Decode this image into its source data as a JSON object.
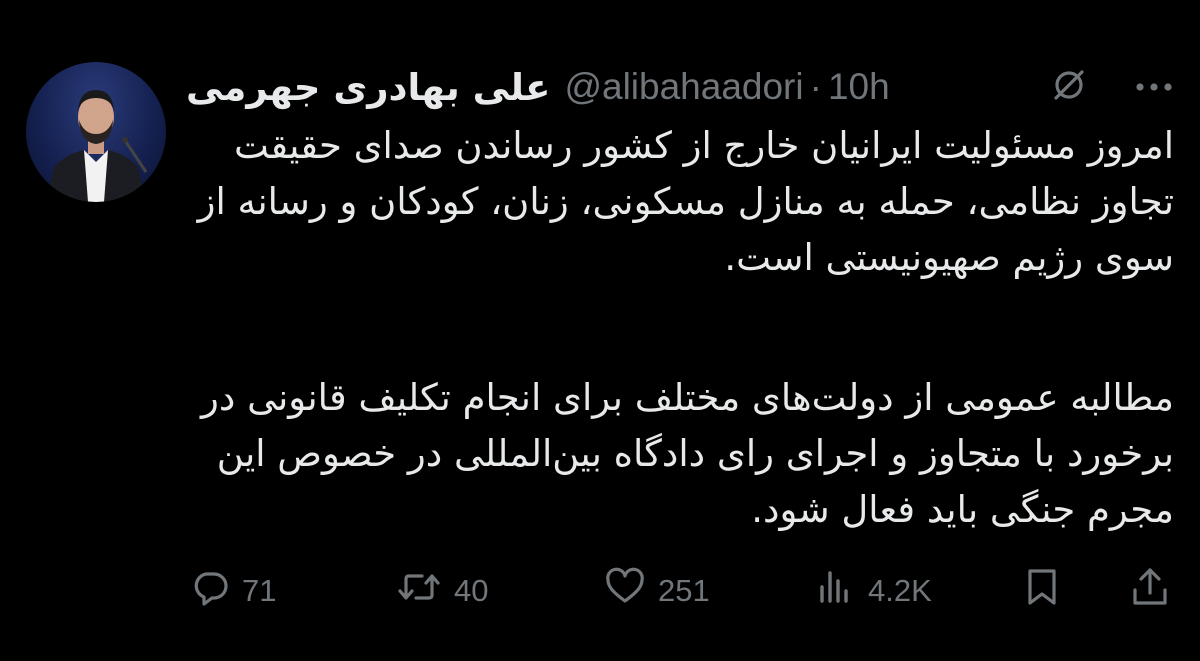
{
  "tweet": {
    "display_name": "علی بهادری جهرمی",
    "handle": "@alibahaadori",
    "separator": "·",
    "time": "10h",
    "paragraphs": [
      "امروز مسئولیت ایرانیان خارج از کشور رساندن صدای حقیقت تجاوز نظامی، حمله به منازل مسکونی، زنان، کودکان و رسانه از سوی رژیم صهیونیستی است.",
      "مطالبه عمومی از دولت‌های مختلف برای انجام تکلیف قانونی در برخورد با متجاوز و اجرای رای دادگاه بین‌المللی در خصوص این مجرم جنگی باید فعال شود."
    ]
  },
  "header_icons": [
    "grok-icon",
    "more-icon"
  ],
  "actions": {
    "reply": {
      "icon": "reply-icon",
      "count": "71"
    },
    "retweet": {
      "icon": "retweet-icon",
      "count": "40"
    },
    "like": {
      "icon": "heart-icon",
      "count": "251"
    },
    "views": {
      "icon": "views-icon",
      "count": "4.2K"
    },
    "bookmark": {
      "icon": "bookmark-icon"
    },
    "share": {
      "icon": "share-icon"
    }
  },
  "colors": {
    "background": "#000000",
    "text": "#e7e9ea",
    "secondary": "#71767b"
  }
}
